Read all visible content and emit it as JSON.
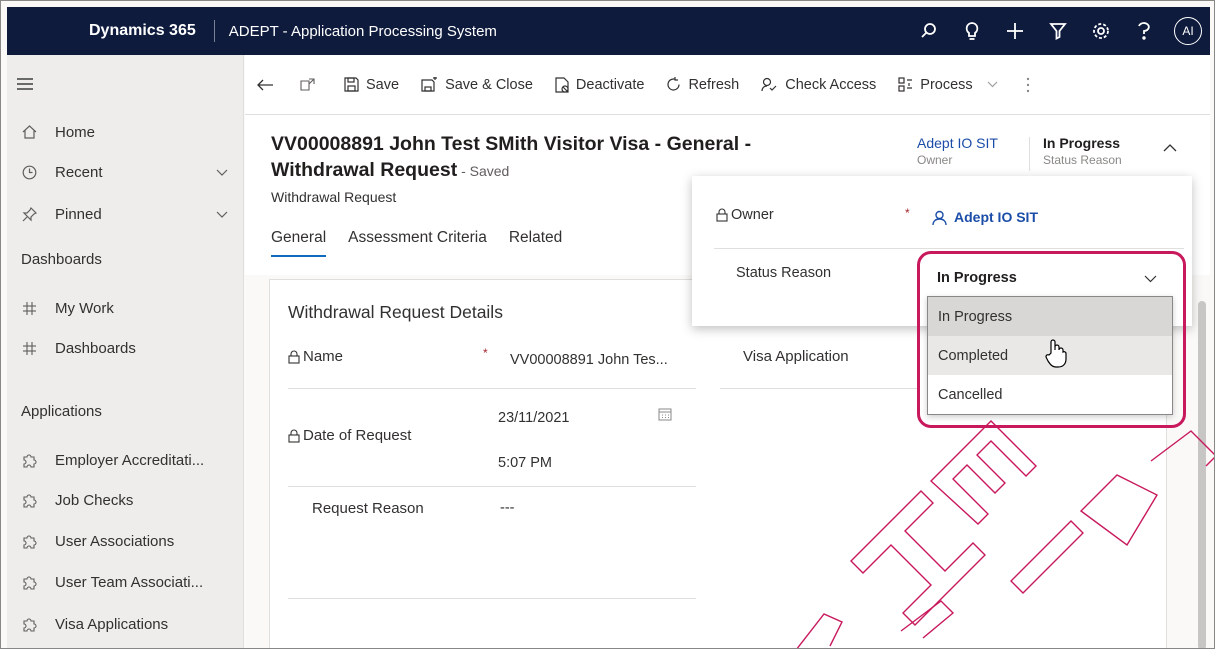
{
  "topbar": {
    "brand": "Dynamics 365",
    "app_title": "ADEPT - Application Processing System",
    "avatar_initials": "AI",
    "icons": [
      "search-icon",
      "lightbulb-icon",
      "plus-icon",
      "filter-icon",
      "gear-icon",
      "help-icon"
    ]
  },
  "sidebar": {
    "items": [
      {
        "label": "Home",
        "icon": "home-icon"
      },
      {
        "label": "Recent",
        "icon": "clock-icon"
      },
      {
        "label": "Pinned",
        "icon": "pin-icon"
      }
    ],
    "group_dashboards": "Dashboards",
    "dashboards": [
      {
        "label": "My Work",
        "icon": "dashboard-icon"
      },
      {
        "label": "Dashboards",
        "icon": "dashboard-icon"
      }
    ],
    "group_applications": "Applications",
    "applications": [
      {
        "label": "Employer Accreditati...",
        "icon": "puzzle-icon"
      },
      {
        "label": "Job Checks",
        "icon": "puzzle-icon"
      },
      {
        "label": "User Associations",
        "icon": "puzzle-icon"
      },
      {
        "label": "User Team Associati...",
        "icon": "puzzle-icon"
      },
      {
        "label": "Visa Applications",
        "icon": "puzzle-icon"
      }
    ]
  },
  "commandbar": {
    "save": "Save",
    "save_close": "Save & Close",
    "deactivate": "Deactivate",
    "refresh": "Refresh",
    "check_access": "Check Access",
    "process": "Process"
  },
  "record": {
    "title_line1": "VV00008891 John Test SMith Visitor Visa - General -",
    "title_line2": "Withdrawal Request",
    "saved": " - Saved",
    "entity": "Withdrawal Request",
    "owner_value": "Adept IO SIT",
    "owner_label": "Owner",
    "status_value": "In Progress",
    "status_label": "Status Reason"
  },
  "tabs": [
    "General",
    "Assessment Criteria",
    "Related"
  ],
  "form": {
    "section_title": "Withdrawal Request Details",
    "name_label": "Name",
    "name_value": "VV00008891 John Tes...",
    "visa_label": "Visa Application",
    "date_label": "Date of Request",
    "date_value": "23/11/2021",
    "time_value": "5:07 PM",
    "reason_label": "Request Reason",
    "reason_value": "---"
  },
  "flyout": {
    "owner_label": "Owner",
    "owner_value": "Adept IO SIT",
    "status_label": "Status Reason",
    "selected": "In Progress",
    "options": [
      "In Progress",
      "Completed",
      "Cancelled"
    ]
  },
  "colors": {
    "topbar": "#0e1b3d",
    "accent": "#0f6cbd",
    "highlight": "#c8195c",
    "link": "#1b4da8"
  }
}
